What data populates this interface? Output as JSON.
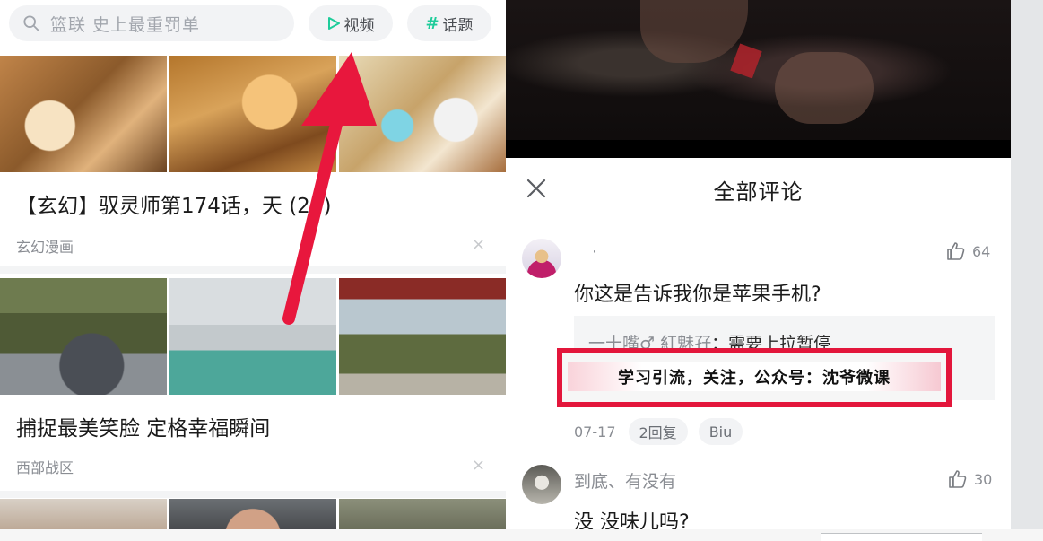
{
  "left_feed": {
    "search": {
      "placeholder": "篮联 史上最重罚单",
      "icon": "search-icon"
    },
    "buttons": {
      "video": "视频",
      "topic": "话题"
    },
    "items": [
      {
        "title": "【玄幻】驭灵师第174话，天  (29)",
        "source": "玄幻漫画"
      },
      {
        "title": "捕捉最美笑脸 定格幸福瞬间",
        "source": "西部战区"
      }
    ],
    "close_symbol": "×"
  },
  "comments": {
    "header_title": "全部评论",
    "list": [
      {
        "username": "·",
        "text": "你这是告诉我你是苹果手机?",
        "likes": "64",
        "date": "07-17",
        "reply_count": "2回复",
        "biu": "Biu"
      },
      {
        "username": "到底、有没有",
        "text": "没  没味儿吗?",
        "likes": "30"
      }
    ],
    "reply_preview": {
      "name": "一十嘴♂ 紅魅孖",
      "text": "：需要上拉暂停"
    }
  },
  "overlay": {
    "text": "学习引流，关注，公众号：沈爷微课"
  },
  "colors": {
    "accent_green": "#1ecc9a",
    "annotation_red": "#e3163b"
  }
}
